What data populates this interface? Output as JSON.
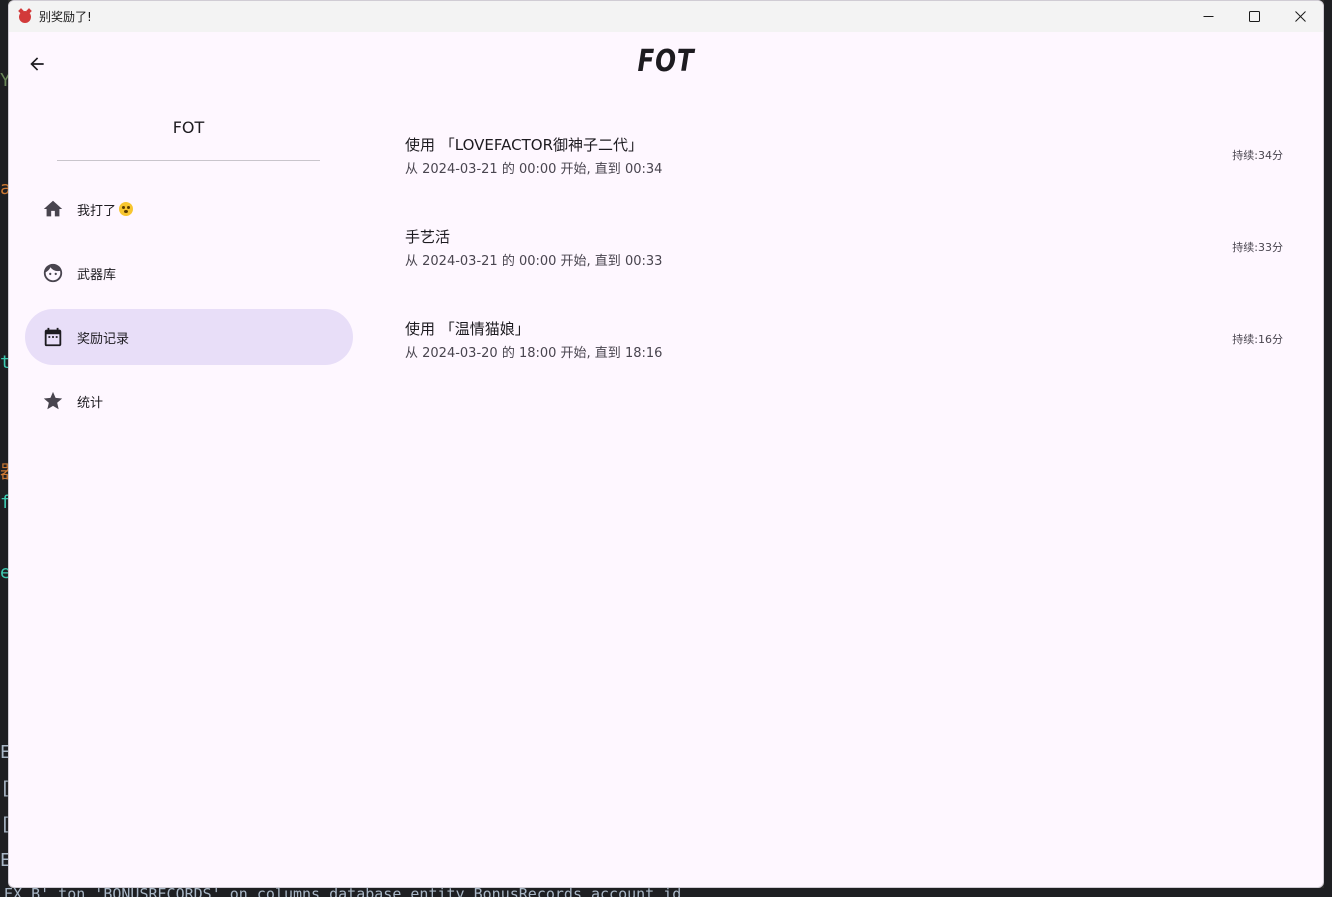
{
  "window": {
    "title": "别奖励了!"
  },
  "appbar": {
    "title": "FOT"
  },
  "drawer": {
    "header": "FOT",
    "items": [
      {
        "label": "我打了",
        "icon": "home-icon",
        "active": false
      },
      {
        "label": "武器库",
        "icon": "face-icon",
        "active": false
      },
      {
        "label": "奖励记录",
        "icon": "calendar-icon",
        "active": true
      },
      {
        "label": "统计",
        "icon": "star-icon",
        "active": false
      }
    ]
  },
  "records": [
    {
      "title": "使用 「LOVEFACTOR御神子二代」",
      "subtitle": "从 2024-03-21 的 00:00 开始, 直到 00:34",
      "duration": "持续:34分"
    },
    {
      "title": "手艺活",
      "subtitle": "从 2024-03-21 的 00:00 开始, 直到 00:33",
      "duration": "持续:33分"
    },
    {
      "title": "使用 「温情猫娘」",
      "subtitle": "从 2024-03-20 的 18:00 开始, 直到 18:16",
      "duration": "持续:16分"
    }
  ],
  "background": {
    "bottom_code": "EX_B' ton 'BONUSRECORDS' on columns database entity BonusRecords account id"
  },
  "colors": {
    "surface": "#fef7ff",
    "active_nav": "#e8def8",
    "text_primary": "#1d1b20",
    "text_secondary": "#49454f"
  }
}
